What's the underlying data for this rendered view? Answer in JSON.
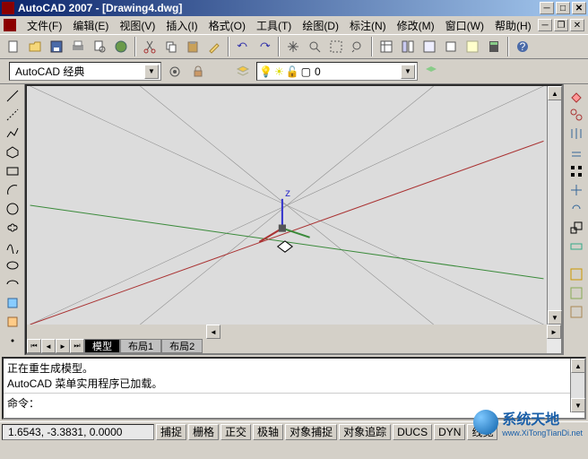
{
  "titlebar": {
    "text": "AutoCAD 2007 - [Drawing4.dwg]"
  },
  "menus": {
    "file": "文件(F)",
    "edit": "编辑(E)",
    "view": "视图(V)",
    "insert": "插入(I)",
    "format": "格式(O)",
    "tools": "工具(T)",
    "draw": "绘图(D)",
    "dimension": "标注(N)",
    "modify": "修改(M)",
    "window": "窗口(W)",
    "help": "帮助(H)"
  },
  "workspace": {
    "selected": "AutoCAD 经典"
  },
  "layer": {
    "current": "0"
  },
  "tabs": {
    "model": "模型",
    "layout1": "布局1",
    "layout2": "布局2"
  },
  "command": {
    "history": "正在重生成模型。\nAutoCAD 菜单实用程序已加载。",
    "prompt": "命令："
  },
  "status": {
    "coords": "1.6543, -3.3831, 0.0000",
    "snap": "捕捉",
    "grid": "栅格",
    "ortho": "正交",
    "polar": "极轴",
    "osnap": "对象捕捉",
    "otrack": "对象追踪",
    "ducs": "DUCS",
    "dyn": "DYN",
    "lwt": "线宽"
  },
  "watermark": {
    "title": "系统天地",
    "url": "www.XiTongTianDi.net"
  }
}
